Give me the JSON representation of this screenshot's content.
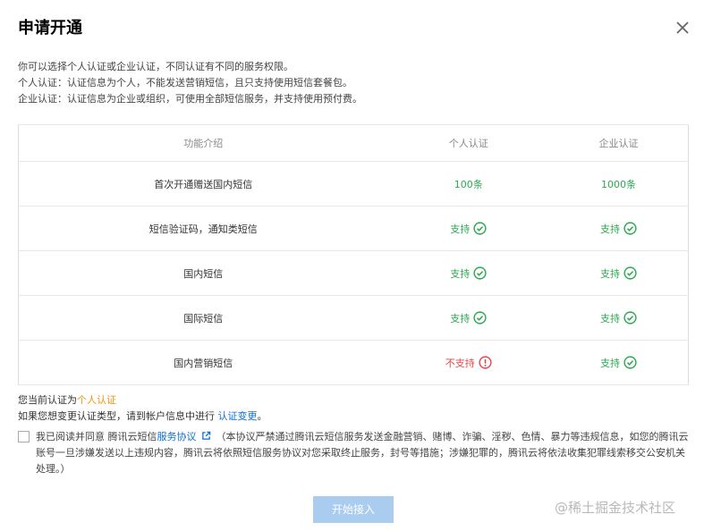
{
  "dialog": {
    "title": "申请开通",
    "intro": [
      "你可以选择个人认证或企业认证，不同认证有不同的服务权限。",
      "个人认证：认证信息为个人，不能发送营销短信，且只支持使用短信套餐包。",
      "企业认证：认证信息为企业或组织，可使用全部短信服务，并支持使用预付费。"
    ]
  },
  "table": {
    "headers": [
      "功能介绍",
      "个人认证",
      "企业认证"
    ],
    "rows": [
      {
        "feature": "首次开通赠送国内短信",
        "personal": "100条",
        "personal_type": "value",
        "enterprise": "1000条",
        "enterprise_type": "value"
      },
      {
        "feature": "短信验证码，通知类短信",
        "personal": "支持",
        "personal_type": "yes",
        "enterprise": "支持",
        "enterprise_type": "yes"
      },
      {
        "feature": "国内短信",
        "personal": "支持",
        "personal_type": "yes",
        "enterprise": "支持",
        "enterprise_type": "yes"
      },
      {
        "feature": "国际短信",
        "personal": "支持",
        "personal_type": "yes",
        "enterprise": "支持",
        "enterprise_type": "yes"
      },
      {
        "feature": "国内营销短信",
        "personal": "不支持",
        "personal_type": "no",
        "enterprise": "支持",
        "enterprise_type": "yes"
      }
    ]
  },
  "status": {
    "current_prefix": "您当前认证为",
    "current_value": "个人认证",
    "change_text": "如果您想变更认证类型，请到帐户信息中进行",
    "change_link": "认证变更",
    "change_suffix": "。"
  },
  "agreement": {
    "prefix": "我已阅读并同意 腾讯云短信",
    "link": "服务协议",
    "notice": "（本协议严禁通过腾讯云短信服务发送金融营销、赌博、诈骗、淫秽、色情、暴力等违规信息，如您的腾讯云账号一旦涉嫌发送以上违规内容，腾讯云将依照短信服务协议对您采取终止服务，封号等措施；涉嫌犯罪的，腾讯云将依法收集犯罪线索移交公安机关处理。）",
    "checked": false
  },
  "buttons": {
    "start": "开始接入"
  },
  "watermark": "@稀土掘金技术社区",
  "colors": {
    "ok": "#29a94f",
    "no": "#e54545",
    "link": "#0b6fd4",
    "highlight": "#f0950c",
    "button_disabled": "#a9ccef"
  },
  "icons": {
    "yes": "check-circle-icon",
    "no": "exclamation-circle-icon",
    "close": "close-icon",
    "external": "external-link-icon"
  }
}
